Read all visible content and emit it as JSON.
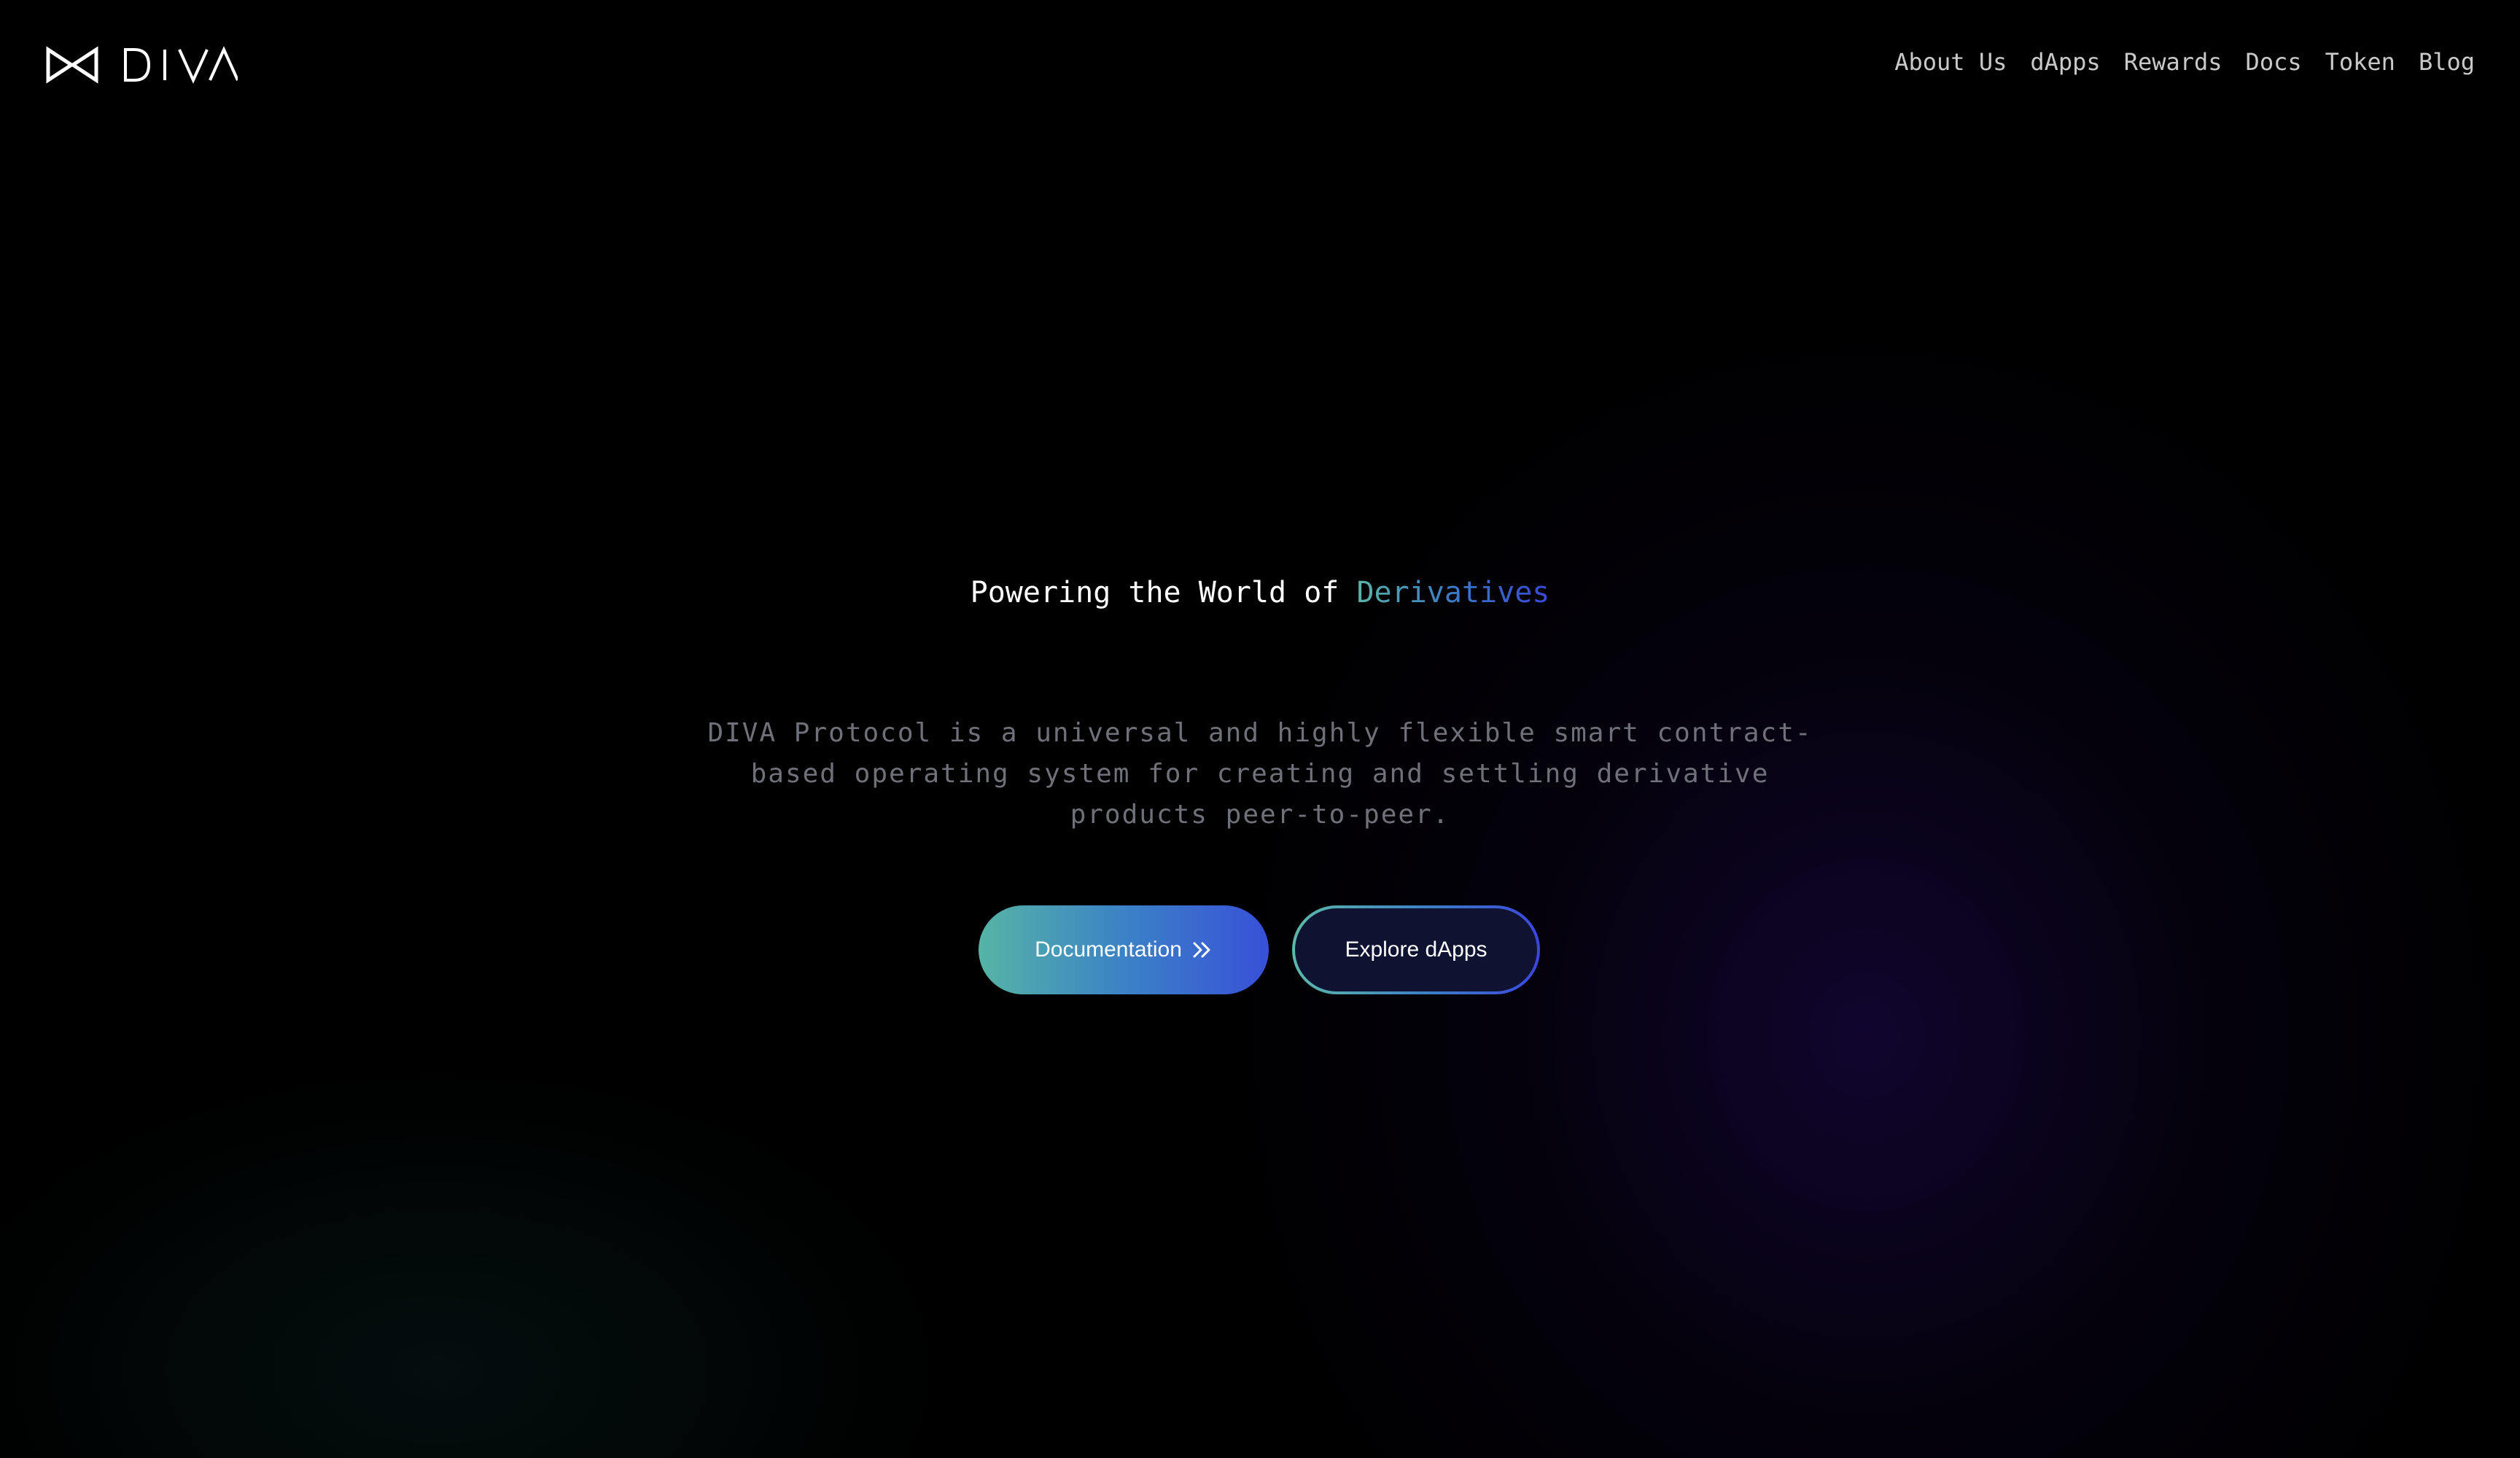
{
  "header": {
    "logo_text": "DIVA",
    "nav": [
      {
        "label": "About Us"
      },
      {
        "label": "dApps"
      },
      {
        "label": "Rewards"
      },
      {
        "label": "Docs"
      },
      {
        "label": "Token"
      },
      {
        "label": "Blog"
      }
    ]
  },
  "hero": {
    "title_prefix": "Powering the World of ",
    "title_accent": "Derivatives",
    "subtitle": "DIVA Protocol is a universal and highly flexible smart contract-based operating system for creating and settling derivative products peer-to-peer.",
    "primary_button": {
      "label": "Documentation",
      "icon": "double-chevron-right-icon"
    },
    "secondary_button": {
      "label": "Explore dApps"
    }
  },
  "colors": {
    "background": "#000000",
    "accent_start": "#5bb4a8",
    "accent_end": "#3848d8",
    "nav_text": "#c9c9c9",
    "subtitle_text": "#6f7079",
    "secondary_button_bg": "#0f1230"
  }
}
